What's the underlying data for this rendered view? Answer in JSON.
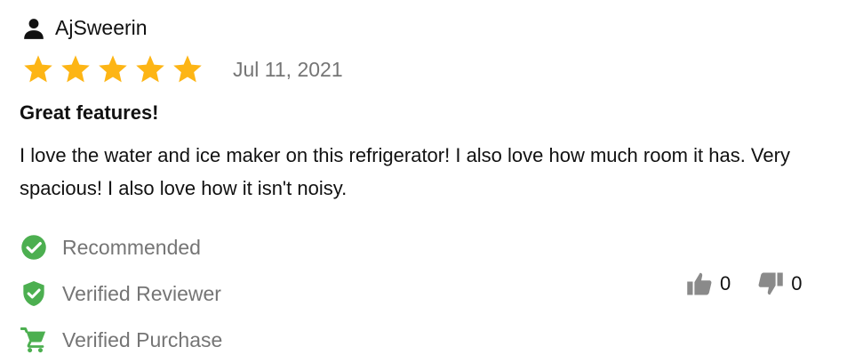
{
  "review": {
    "author": "AjSweerin",
    "rating": 5,
    "rating_max": 5,
    "date": "Jul 11, 2021",
    "title": "Great features!",
    "body": "I love the water and ice maker on this refrigerator! I also love how much room it has. Very spacious! I also love how it isn't noisy."
  },
  "badges": [
    {
      "label": "Recommended",
      "icon": "check-circle-icon"
    },
    {
      "label": "Verified Reviewer",
      "icon": "shield-check-icon"
    },
    {
      "label": "Verified Purchase",
      "icon": "cart-icon"
    }
  ],
  "votes": {
    "helpful": {
      "icon": "thumbs-up-icon",
      "count": "0"
    },
    "unhelpful": {
      "icon": "thumbs-down-icon",
      "count": "0"
    }
  },
  "colors": {
    "star": "#FDB515",
    "badge_green": "#4CAF50",
    "muted_text": "#757575",
    "vote_icon": "#8A8A8A"
  }
}
